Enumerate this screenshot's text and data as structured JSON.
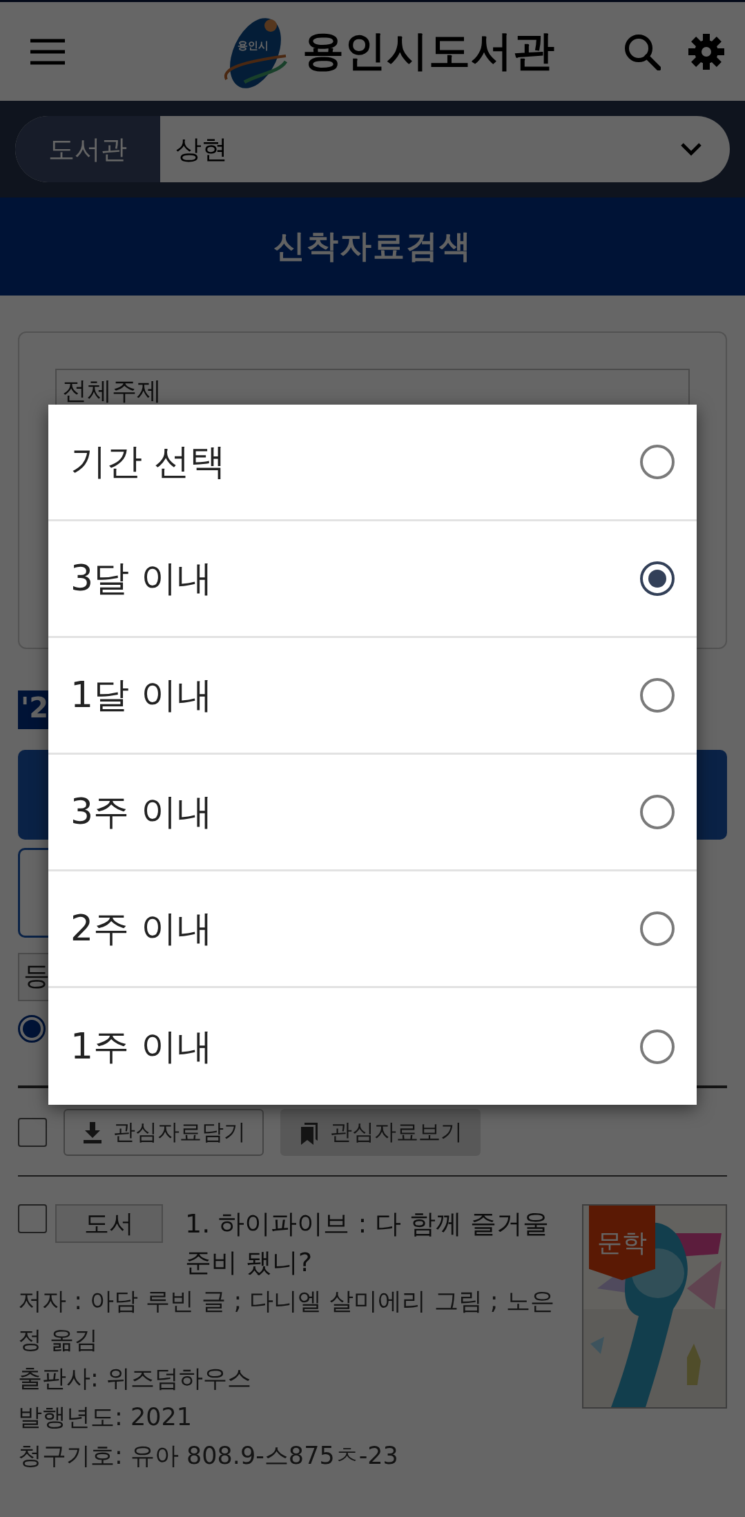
{
  "header": {
    "logo_text": "용인시",
    "title": "용인시도서관"
  },
  "library_selector": {
    "label": "도서관",
    "value": "상현"
  },
  "banner": {
    "title": "신착자료검색"
  },
  "filter": {
    "subject_value": "전체주제"
  },
  "year_tag": "'2",
  "sort_value": "등",
  "sort_radio": {
    "selected": true
  },
  "toolbar": {
    "select_all": {
      "checked": false
    },
    "buttons": [
      {
        "label": "관심자료담기",
        "kind": "download"
      },
      {
        "label": "관심자료보기",
        "kind": "bookmark"
      }
    ]
  },
  "results": [
    {
      "checked": false,
      "type": "도서",
      "title": "1. 하이파이브 : 다 함께 즐거울 준비 됐니?",
      "category": "문학",
      "author": "저자 : 아담 루빈 글 ; 다니엘 살미에리 그림 ; 노은정 옮김",
      "publisher": "출판사: 위즈덤하우스",
      "year": "발행년도: 2021",
      "call_number": "청구기호: 유아 808.9-스875ㅊ-23"
    }
  ],
  "dialog": {
    "options": [
      {
        "label": "기간 선택",
        "selected": false
      },
      {
        "label": "3달 이내",
        "selected": true
      },
      {
        "label": "1달 이내",
        "selected": false
      },
      {
        "label": "3주 이내",
        "selected": false
      },
      {
        "label": "2주 이내",
        "selected": false
      },
      {
        "label": "1주 이내",
        "selected": false
      }
    ]
  }
}
